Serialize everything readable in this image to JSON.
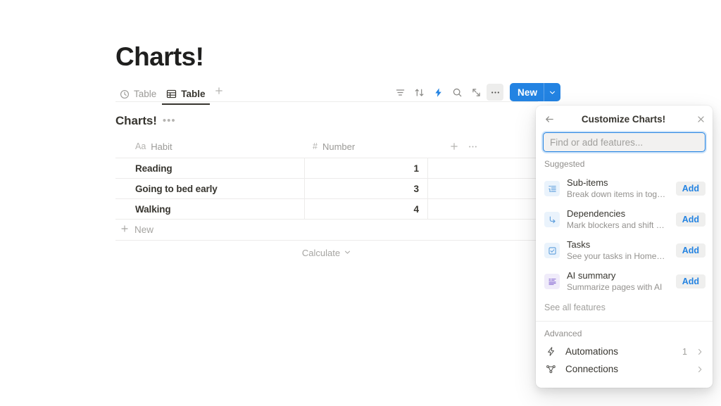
{
  "page": {
    "title": "Charts!"
  },
  "view_tabs": [
    {
      "label": "Table",
      "icon": "clock-icon",
      "active": false
    },
    {
      "label": "Table",
      "icon": "table-grid-icon",
      "active": true
    }
  ],
  "tab_add": {
    "icon": "plus-icon"
  },
  "toolbar": {
    "icons": [
      {
        "name": "filter-icon"
      },
      {
        "name": "sort-icon"
      },
      {
        "name": "lightning-icon"
      },
      {
        "name": "search-icon"
      },
      {
        "name": "expand-icon"
      },
      {
        "name": "more-options-icon"
      }
    ],
    "new_label": "New",
    "accent_color": "#2383e2"
  },
  "database": {
    "title": "Charts!",
    "columns": [
      {
        "label": "Habit",
        "type_icon": "Aa"
      },
      {
        "label": "Number",
        "type_icon": "#"
      }
    ],
    "rows": [
      {
        "habit": "Reading",
        "number": "1"
      },
      {
        "habit": "Going to bed early",
        "number": "3"
      },
      {
        "habit": "Walking",
        "number": "4"
      }
    ],
    "new_row_label": "New",
    "calculate_label": "Calculate"
  },
  "panel": {
    "title": "Customize Charts!",
    "back_icon": "arrow-left-icon",
    "close_icon": "close-icon",
    "search": {
      "placeholder": "Find or add features...",
      "value": ""
    },
    "suggested_label": "Suggested",
    "features": [
      {
        "name": "Sub-items",
        "desc": "Break down items in toggles",
        "icon": "sub-items-icon",
        "action": "Add"
      },
      {
        "name": "Dependencies",
        "desc": "Mark blockers and shift dates",
        "icon": "dependencies-arrow-icon",
        "action": "Add"
      },
      {
        "name": "Tasks",
        "desc": "See your tasks in Home, ma…",
        "icon": "checkbox-icon",
        "action": "Add"
      },
      {
        "name": "AI summary",
        "desc": "Summarize pages with AI",
        "icon": "ai-summary-icon",
        "action": "Add"
      }
    ],
    "see_all_label": "See all features",
    "advanced_label": "Advanced",
    "advanced_items": [
      {
        "label": "Automations",
        "icon": "lightning-icon",
        "count": "1"
      },
      {
        "label": "Connections",
        "icon": "connections-icon",
        "count": ""
      }
    ]
  }
}
